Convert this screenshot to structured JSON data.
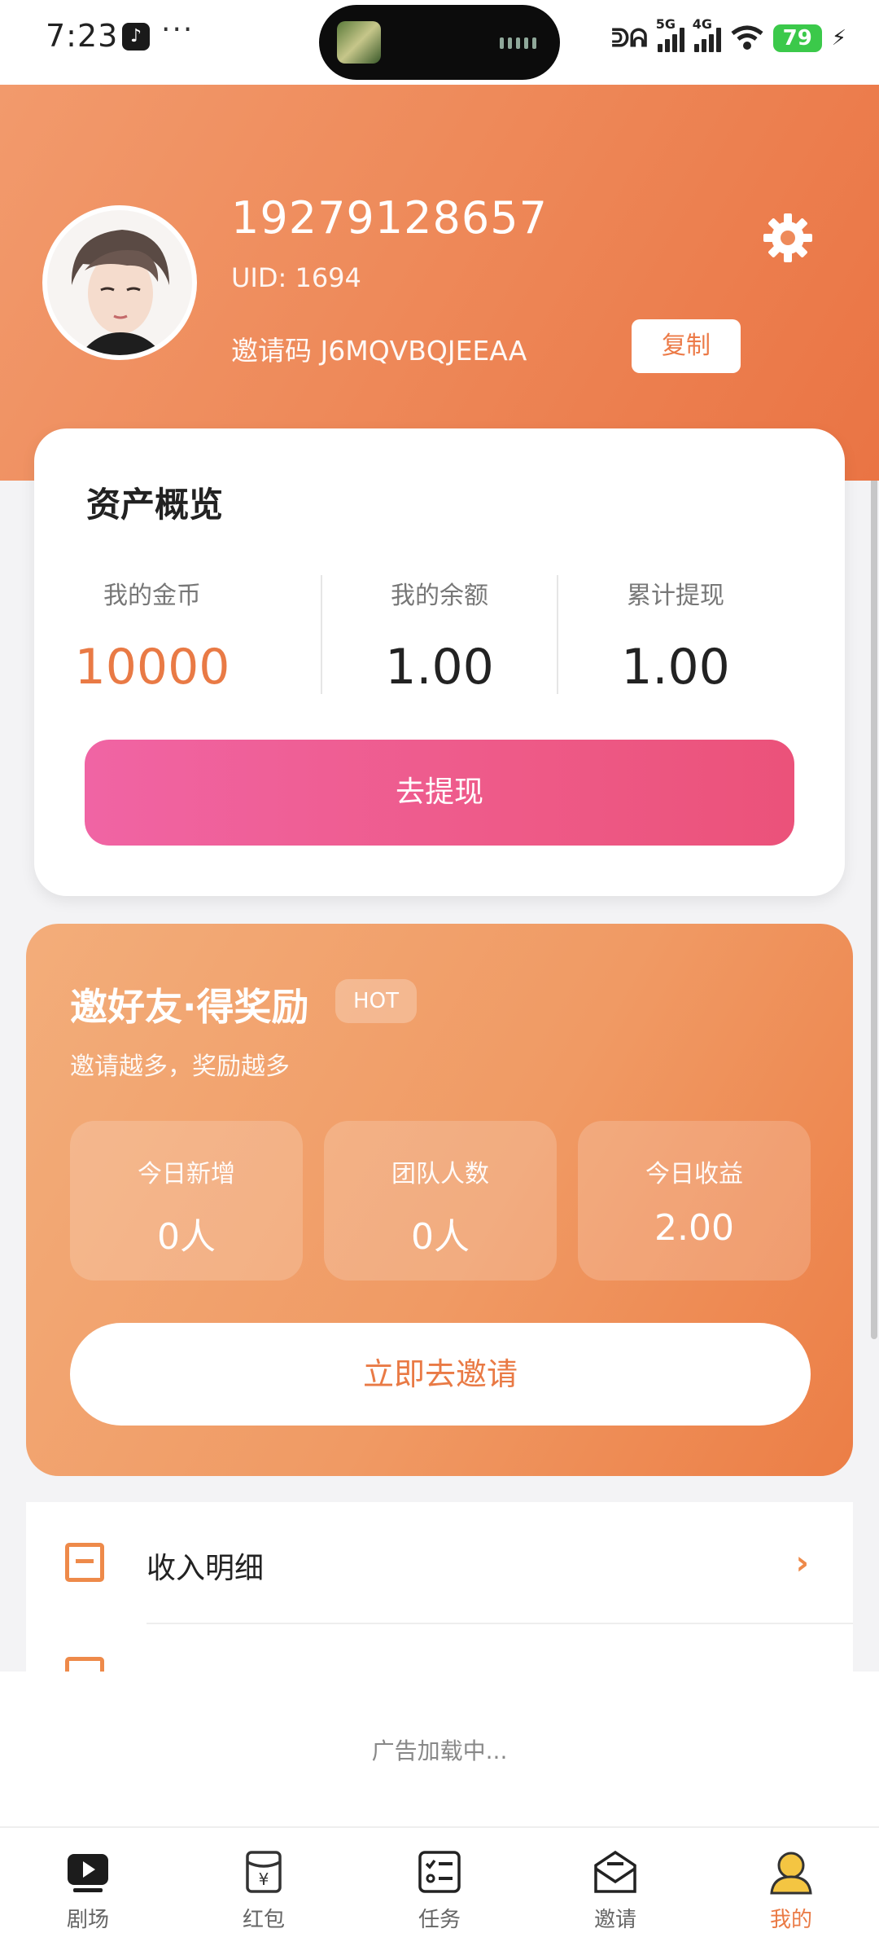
{
  "status_bar": {
    "time": "7:23",
    "dots": "···",
    "network_a": "5G",
    "network_b": "4G",
    "battery": "79"
  },
  "profile": {
    "phone": "19279128657",
    "uid": "UID: 1694",
    "invite_code": "邀请码 J6MQVBQJEEAA",
    "copy_label": "复制"
  },
  "assets": {
    "title": "资产概览",
    "stats": [
      {
        "label": "我的金币",
        "value": "10000"
      },
      {
        "label": "我的余额",
        "value": "1.00"
      },
      {
        "label": "累计提现",
        "value": "1.00"
      }
    ],
    "withdraw_label": "去提现"
  },
  "invite": {
    "title": "邀好友·得奖励",
    "badge": "HOT",
    "subtitle": "邀请越多，奖励越多",
    "stats": [
      {
        "label": "今日新增",
        "value": "0人"
      },
      {
        "label": "团队人数",
        "value": "0人"
      },
      {
        "label": "今日收益",
        "value": "2.00"
      }
    ],
    "button_label": "立即去邀请"
  },
  "menu": {
    "items": [
      {
        "label": "收入明细"
      }
    ]
  },
  "ad": {
    "text": "广告加载中..."
  },
  "nav": {
    "items": [
      {
        "label": "剧场",
        "icon": "play-icon"
      },
      {
        "label": "红包",
        "icon": "red-envelope-icon"
      },
      {
        "label": "任务",
        "icon": "task-list-icon"
      },
      {
        "label": "邀请",
        "icon": "mail-icon"
      },
      {
        "label": "我的",
        "icon": "user-icon"
      }
    ],
    "active_index": 4
  },
  "colors": {
    "accent": "#ea7a45",
    "withdraw_button": "#ee5a88",
    "header": "#ee8a5a"
  }
}
